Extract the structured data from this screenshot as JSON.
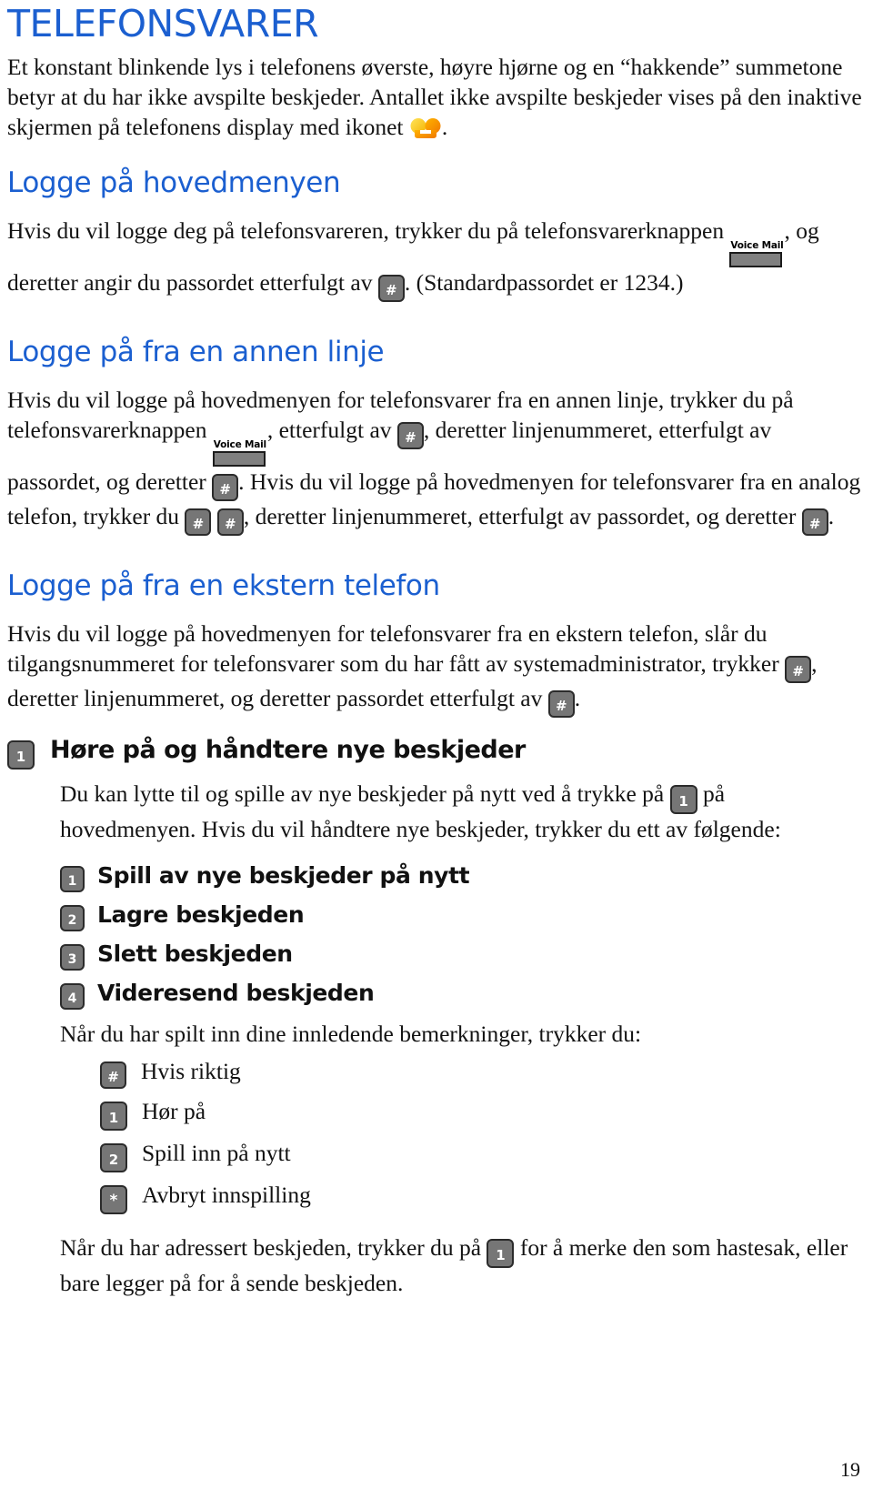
{
  "document": {
    "title": "TELEFONSVARER",
    "page_number": "19"
  },
  "intro": {
    "text_1": "Et konstant blinkende lys i telefonens øverste, høyre hjørne og en “hakkende” summetone betyr at du har ikke avspilte beskjeder. Antallet ikke avspilte beskjeder vises på den inaktive skjermen på telefonens display med ikonet",
    "text_2": "."
  },
  "icons": {
    "voicemail_waiting": "voicemail-waiting-icon",
    "voice_mail_button_label": "Voice Mail",
    "hash_key": "#",
    "star_key": "*"
  },
  "sections": [
    {
      "heading": "Logge på hovedmenyen",
      "paragraph_parts": {
        "p1": "Hvis du vil logge deg på telefonsvareren, trykker du på telefonsvarerknappen",
        "p2": ", og deretter angir du passordet etterfulgt av",
        "p3": ". (Standardpassordet er 1234.)"
      }
    },
    {
      "heading": "Logge på fra en annen linje",
      "paragraph_parts": {
        "p1": "Hvis du vil logge på hovedmenyen for telefonsvarer fra en annen linje, trykker du på telefonsvarerknappen",
        "p2": ", etterfulgt av",
        "p3": ", deretter linjenummeret, etterfulgt av passordet, og deretter",
        "p4": ". Hvis du vil logge på hovedmenyen for telefonsvarer fra en analog telefon, trykker du",
        "p5": ", deretter linjenummeret, etterfulgt av passordet, og deretter",
        "p6": "."
      }
    },
    {
      "heading": "Logge på fra en ekstern telefon",
      "paragraph_parts": {
        "p1": "Hvis du vil logge på hovedmenyen for telefonsvarer fra en ekstern telefon, slår du tilgangsnummeret for telefonsvarer som du har fått av systemadministrator, trykker",
        "p2": ", deretter linjenummeret, og deretter passordet etterfulgt av",
        "p3": "."
      }
    }
  ],
  "listen_section": {
    "key": "1",
    "heading": "Høre på og håndtere nye beskjeder",
    "body_parts": {
      "p1": "Du kan lytte til og spille av nye beskjeder på nytt ved å trykke på",
      "p2": "på hovedmenyen. Hvis du vil håndtere nye beskjeder, trykker du ett av følgende:"
    },
    "key_inline": "1",
    "options": [
      {
        "key": "1",
        "label": "Spill av nye beskjeder på nytt"
      },
      {
        "key": "2",
        "label": "Lagre beskjeden"
      },
      {
        "key": "3",
        "label": "Slett beskjeden"
      },
      {
        "key": "4",
        "label": "Videresend beskjeden"
      }
    ],
    "after_recording_intro": "Når du har spilt inn dine innledende bemerkninger, trykker du:",
    "after_recording_options": [
      {
        "key": "#",
        "label": "Hvis riktig"
      },
      {
        "key": "1",
        "label": "Hør på"
      },
      {
        "key": "2",
        "label": "Spill inn på nytt"
      },
      {
        "key": "*",
        "label": "Avbryt innspilling"
      }
    ],
    "closing_parts": {
      "p1": "Når du har adressert beskjeden, trykker du på",
      "p2": "for å merke den som hastesak, eller bare legger på for å sende beskjeden."
    },
    "closing_key": "1"
  },
  "colors": {
    "heading_blue": "#1b5fd0",
    "key_gray": "#767676",
    "key_border": "#2b2b2b",
    "icon_orange": "#f39200",
    "icon_yellow": "#ffd400",
    "text_black": "#131313"
  }
}
